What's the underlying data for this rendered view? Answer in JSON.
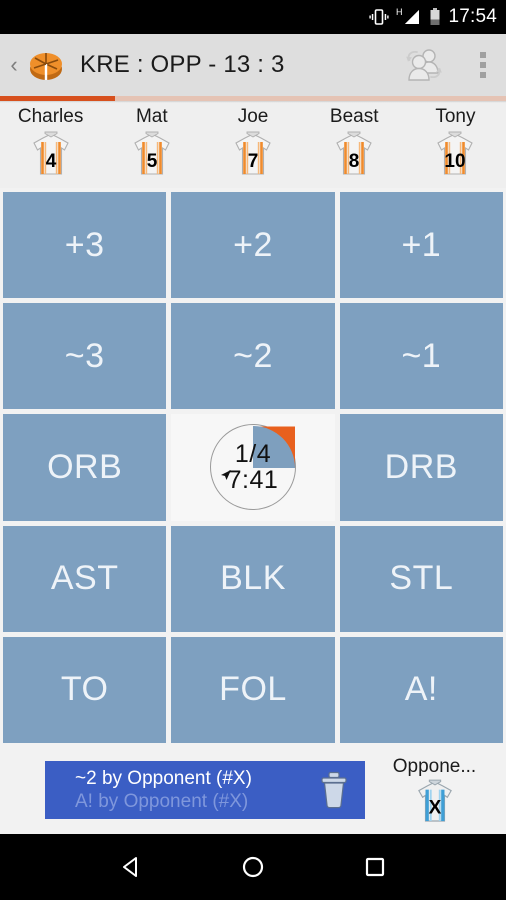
{
  "statusbar": {
    "time": "17:54",
    "icons": [
      "vibrate-icon",
      "signal-h-icon",
      "battery-icon"
    ]
  },
  "appbar": {
    "back_label": "‹",
    "logo": "basketball-logo",
    "title": "KRE : OPP - 13 : 3",
    "swap_players_icon": "swap-players-icon",
    "overflow_icon": "overflow-menu-icon",
    "accent_color": "#d7501d",
    "background_color": "#dedede"
  },
  "players": [
    {
      "name": "Charles",
      "number": "4"
    },
    {
      "name": "Mat",
      "number": "5"
    },
    {
      "name": "Joe",
      "number": "7"
    },
    {
      "name": "Beast",
      "number": "8"
    },
    {
      "name": "Tony",
      "number": "10"
    }
  ],
  "grid": {
    "button_color": "#7ea0c0",
    "text_color": "#eef3f8",
    "buttons": [
      {
        "label": "+3"
      },
      {
        "label": "+2"
      },
      {
        "label": "+1"
      },
      {
        "label": "~3"
      },
      {
        "label": "~2"
      },
      {
        "label": "~1"
      },
      {
        "label": "ORB"
      },
      {
        "label": "__CLOCK__"
      },
      {
        "label": "DRB"
      },
      {
        "label": "AST"
      },
      {
        "label": "BLK"
      },
      {
        "label": "STL"
      },
      {
        "label": "TO"
      },
      {
        "label": "FOL"
      },
      {
        "label": "A!"
      }
    ]
  },
  "clock": {
    "quarter": "1/4",
    "time": "7:41",
    "wedge_color": "#7e9fbe",
    "arc_color": "#e8601e"
  },
  "undo": {
    "line1": "~2 by Opponent (#X)",
    "line2": "A! by Opponent (#X)",
    "background_color": "#3b5ec4",
    "trash_icon": "trash-icon"
  },
  "opponent": {
    "name": "Oppone...",
    "number": "X"
  },
  "navbar": {
    "back": "nav-back-icon",
    "home": "nav-home-icon",
    "recents": "nav-recents-icon"
  }
}
